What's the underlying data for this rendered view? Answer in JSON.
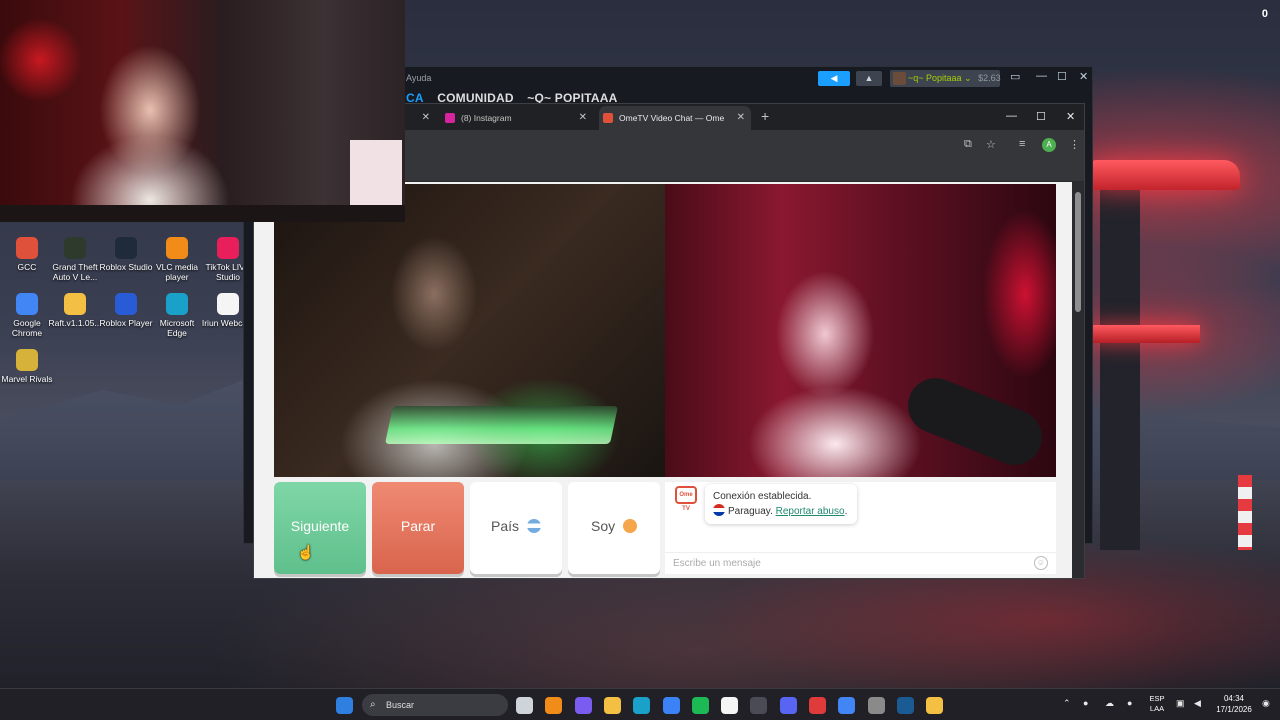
{
  "desktop": {
    "corner_counter": "0",
    "icons": [
      {
        "label": "GCC",
        "icon": "gcc-icon",
        "color": "#e0513b"
      },
      {
        "label": "Grand Theft Auto V Le...",
        "icon": "gta-icon",
        "color": "#2e3b2c"
      },
      {
        "label": "Roblox Studio",
        "icon": "roblox-studio-icon",
        "color": "#1f2b3a"
      },
      {
        "label": "VLC media player",
        "icon": "vlc-icon",
        "color": "#f28c18"
      },
      {
        "label": "TikTok LIVE Studio",
        "icon": "tiktok-icon",
        "color": "#e81f5a"
      },
      {
        "label": "Google Chrome",
        "icon": "chrome-icon",
        "color": "#4285f4"
      },
      {
        "label": "Raft.v1.1.05...",
        "icon": "folder-icon",
        "color": "#f3c044"
      },
      {
        "label": "Roblox Player",
        "icon": "roblox-player-icon",
        "color": "#2a5bd7"
      },
      {
        "label": "Microsoft Edge",
        "icon": "edge-icon",
        "color": "#1aa1c9"
      },
      {
        "label": "Iriun Webcam",
        "icon": "iriun-icon",
        "color": "#f5f5f5"
      },
      {
        "label": "Marvel Rivals",
        "icon": "marvel-rivals-icon",
        "color": "#d7b23a"
      }
    ]
  },
  "steam": {
    "help_menu": "Ayuda",
    "nav": [
      "CA",
      "COMUNIDAD",
      "~Q~ POPITAAA"
    ],
    "user_label": "~q~ Popitaaa",
    "wallet": "$2.63"
  },
  "chrome": {
    "tabs": [
      {
        "label": "",
        "favicon_color": "#3c4043",
        "active": false
      },
      {
        "label": "(8) Instagram",
        "favicon_color": "#d6249f",
        "active": false
      },
      {
        "label": "OmeTV Video Chat — Ome",
        "favicon_color": "#e0513b",
        "active": true
      }
    ],
    "profile_initial": "A"
  },
  "ometv": {
    "buttons": {
      "next": "Siguiente",
      "stop": "Parar",
      "country": "País",
      "me": "Soy"
    },
    "logo_text": "Ome TV",
    "chat": {
      "status": "Conexión establecida.",
      "country": "Paraguay.",
      "report": "Reportar abuso",
      "report_suffix": ".",
      "placeholder": "Escribe un mensaje"
    }
  },
  "taskbar": {
    "search_label": "Buscar",
    "language_line1": "ESP",
    "language_line2": "LAA",
    "time": "04:34",
    "date": "17/1/2026",
    "apps": [
      {
        "icon": "task-view-icon",
        "color": "#cfd3da"
      },
      {
        "icon": "vlc-taskbar-icon",
        "color": "#f28c18"
      },
      {
        "icon": "copilot-icon",
        "color": "#7a5cf0"
      },
      {
        "icon": "file-explorer-icon",
        "color": "#f3c044"
      },
      {
        "icon": "edge-taskbar-icon",
        "color": "#1aa1c9"
      },
      {
        "icon": "store-icon",
        "color": "#3b82f6"
      },
      {
        "icon": "spotify-icon",
        "color": "#1db954"
      },
      {
        "icon": "capcut-icon",
        "color": "#f5f5f5"
      },
      {
        "icon": "obs-icon",
        "color": "#4b4b55"
      },
      {
        "icon": "discord-icon",
        "color": "#5865f2"
      },
      {
        "icon": "streamlabs-icon",
        "color": "#e03b3b"
      },
      {
        "icon": "chrome-taskbar-icon",
        "color": "#4285f4"
      },
      {
        "icon": "rockstar-icon",
        "color": "#8a8a8a"
      },
      {
        "icon": "steam-taskbar-icon",
        "color": "#1b5b93"
      },
      {
        "icon": "file-icon",
        "color": "#f3c044"
      }
    ]
  }
}
